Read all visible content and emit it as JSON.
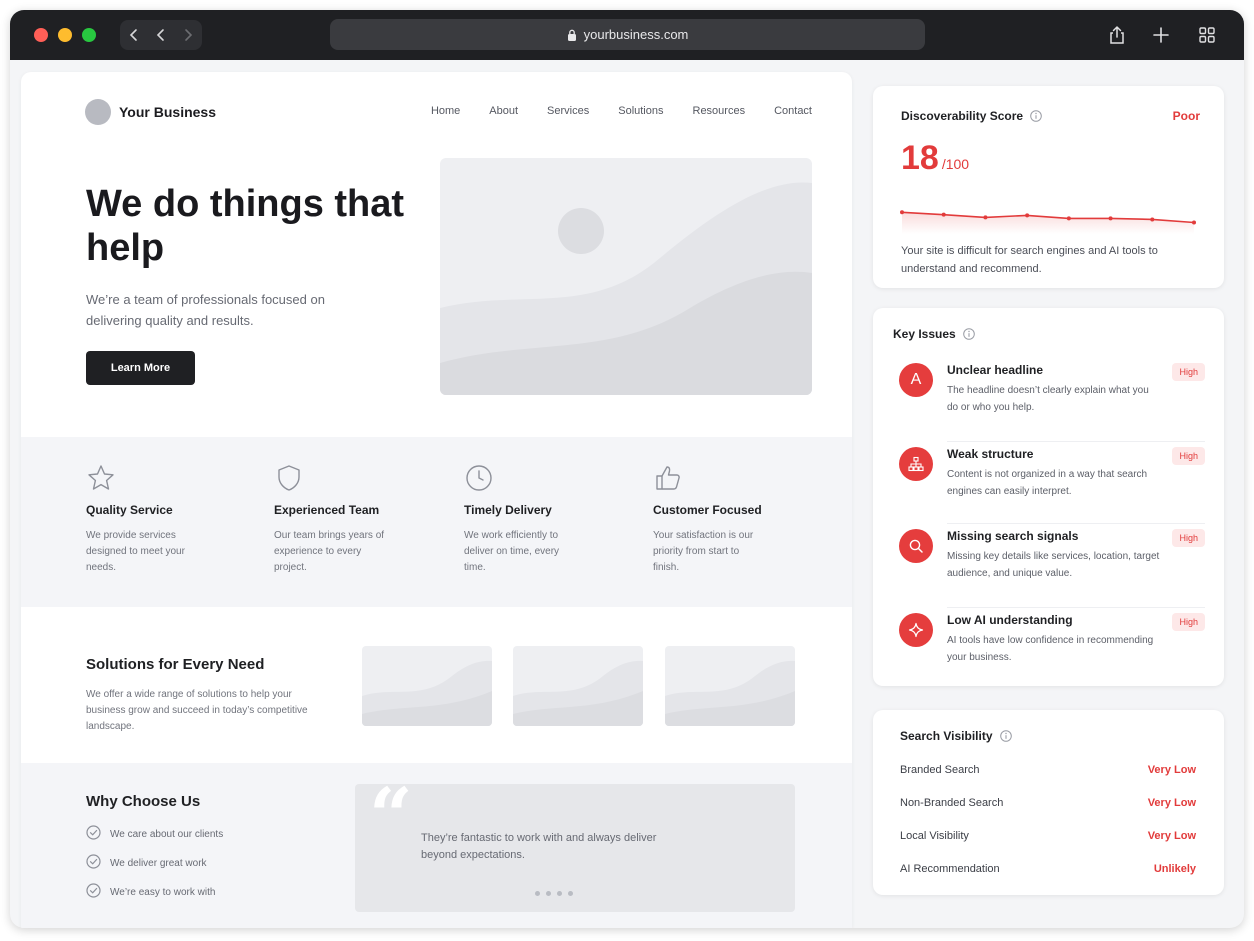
{
  "browser": {
    "url": "yourbusiness.com",
    "icons": [
      "sidebar-icon",
      "back-icon",
      "forward-icon",
      "lock-icon",
      "share-icon",
      "new-tab-icon",
      "tab-overview-icon"
    ]
  },
  "site": {
    "brand": "Your Business",
    "nav": [
      "Home",
      "About",
      "Services",
      "Solutions",
      "Resources",
      "Contact"
    ],
    "hero": {
      "title": "We do things that help",
      "subtitle": "We’re a team of professionals focused on delivering quality and results.",
      "cta": "Learn More"
    },
    "features": [
      {
        "icon": "star-icon",
        "title": "Quality Service",
        "desc": "We provide services designed to meet your needs."
      },
      {
        "icon": "shield-icon",
        "title": "Experienced Team",
        "desc": "Our team brings years of experience to every project."
      },
      {
        "icon": "clock-icon",
        "title": "Timely Delivery",
        "desc": "We work efficiently to deliver on time, every time."
      },
      {
        "icon": "thumbs-up-icon",
        "title": "Customer Focused",
        "desc": "Your satisfaction is our priority from start to finish."
      }
    ],
    "solutions": {
      "title": "Solutions for Every Need",
      "desc": "We offer a wide range of solutions to help your business grow and succeed in today’s competitive landscape."
    },
    "why": {
      "title": "Why Choose Us",
      "items": [
        "We care about our clients",
        "We deliver great work",
        "We’re easy to work with"
      ],
      "quote": "They’re fantastic to work with and always deliver beyond expectations."
    }
  },
  "score_card": {
    "title": "Discoverability Score",
    "rating": "Poor",
    "score": "18",
    "max": "/100",
    "trend": [
      0.55,
      0.48,
      0.4,
      0.46,
      0.37,
      0.37,
      0.34,
      0.25
    ],
    "desc": "Your site is difficult for search engines and AI tools to understand and recommend."
  },
  "issues_card": {
    "title": "Key Issues",
    "items": [
      {
        "icon": "letter-a-icon",
        "title": "Unclear headline",
        "desc": "The headline doesn’t clearly explain what you do or who you help.",
        "severity": "High"
      },
      {
        "icon": "sitemap-icon",
        "title": "Weak structure",
        "desc": "Content is not organized in a way that search engines can easily interpret.",
        "severity": "High"
      },
      {
        "icon": "search-icon",
        "title": "Missing search signals",
        "desc": "Missing key details like services, location, target audience, and unique value.",
        "severity": "High"
      },
      {
        "icon": "sparkle-icon",
        "title": "Low AI understanding",
        "desc": "AI tools have low confidence in recommending your business.",
        "severity": "High"
      }
    ]
  },
  "visibility_card": {
    "title": "Search Visibility",
    "rows": [
      {
        "label": "Branded Search",
        "value": "Very Low"
      },
      {
        "label": "Non-Branded Search",
        "value": "Very Low"
      },
      {
        "label": "Local Visibility",
        "value": "Very Low"
      },
      {
        "label": "AI Recommendation",
        "value": "Unlikely"
      }
    ]
  },
  "colors": {
    "accent": "#e23b3b",
    "titlebar": "#1f2023",
    "button": "#1f2023"
  }
}
